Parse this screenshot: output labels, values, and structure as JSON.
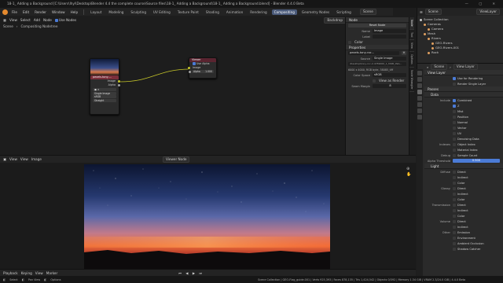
{
  "window": {
    "title": "18-1_ Adding a Background [C:\\Users\\lhyl\\Desktop\\Blender 4.4 the complete course\\Source files\\18-1_ Adding a Background\\18-1_ Adding a Background.blend] - Blender 4.4.0 Beta"
  },
  "menus": [
    "File",
    "Edit",
    "Render",
    "Window",
    "Help"
  ],
  "workspaces": [
    "Layout",
    "Modeling",
    "Sculpting",
    "UV Editing",
    "Texture Paint",
    "Shading",
    "Animation",
    "Rendering",
    "Compositing",
    "Geometry Nodes",
    "Scripting"
  ],
  "active_workspace": "Compositing",
  "scene_label": "Scene",
  "view_layer_label": "ViewLayer",
  "node_editor": {
    "header_items": [
      "View",
      "Select",
      "Add",
      "Node"
    ],
    "use_nodes": "Use Nodes",
    "backdrop": "Backdrop",
    "breadcrumb": [
      "Scene",
      "Compositing Nodetree"
    ],
    "image_node": {
      "title": "pexels-tony-...",
      "outputs": [
        "Image",
        "Alpha"
      ],
      "fields": [
        "Single Image",
        "sRGB",
        "Straight"
      ],
      "field_labels": [
        "",
        "Colo...",
        "Alpha"
      ]
    },
    "viewer_node": {
      "title": "Viewer",
      "rows": [
        "Use Alpha",
        "Image",
        "Alpha"
      ],
      "alpha_value": "1.000"
    }
  },
  "npanel": {
    "node_section": "Node",
    "reset_node": "Reset Node",
    "name_label": "Name",
    "name_value": "Image",
    "label_label": "Label",
    "color_section": "Color",
    "properties_section": "Properties",
    "image_name": "pexels-tony-roc...",
    "source_label": "Source",
    "source_value": "Single Image",
    "file_path": "\\Desktop\\tony-roc-2-4789000_1_MOB_09A...",
    "image_info": "6000 x 4000, RGB byte, 38085_tiff",
    "color_space_label": "Color Space",
    "color_space_value": "sRGB",
    "view_as_render": "View as Render",
    "seam_margin_label": "Seam Margin",
    "seam_margin_value": "8",
    "tabs": [
      "Node",
      "Tool",
      "View",
      "Options",
      "Node Wrangler"
    ]
  },
  "image_editor": {
    "header_items": [
      "View",
      "View",
      "Image"
    ],
    "image_name": "Viewer Node",
    "playback": [
      "Playback",
      "Keying",
      "View",
      "Marker"
    ]
  },
  "outliner": {
    "title": "Scene",
    "items": [
      {
        "label": "Scene Collection",
        "color": "#cccccc",
        "indent": 0
      },
      {
        "label": "Cameras",
        "color": "#e0a060",
        "indent": 1
      },
      {
        "label": "Camera",
        "color": "#e0a060",
        "indent": 2
      },
      {
        "label": "Mesh",
        "color": "#e0a060",
        "indent": 1
      },
      {
        "label": "Rivers",
        "color": "#e0a060",
        "indent": 2
      },
      {
        "label": "GEO-Rivers",
        "color": "#e0a060",
        "indent": 3
      },
      {
        "label": "GEO-Rivers.001",
        "color": "#e0a060",
        "indent": 3
      },
      {
        "label": "Rock",
        "color": "#e0a060",
        "indent": 2
      }
    ]
  },
  "properties": {
    "search_scene": "Scene",
    "search_viewlayer": "View Layer",
    "view_layer_section": "View Layer",
    "use_for_rendering": "Use for Rendering",
    "render_single_layer": "Render Single Layer",
    "passes_section": "Passes",
    "data_section": "Data",
    "include_label": "Include",
    "include_items": [
      {
        "label": "Combined",
        "on": true
      },
      {
        "label": "Z",
        "on": true
      },
      {
        "label": "Mist",
        "on": false
      },
      {
        "label": "Position",
        "on": false
      },
      {
        "label": "Normal",
        "on": false
      },
      {
        "label": "Vector",
        "on": false
      },
      {
        "label": "UV",
        "on": false
      },
      {
        "label": "Denoising Data",
        "on": false
      }
    ],
    "indexes_label": "Indexes",
    "indexes_items": [
      "Object Index",
      "Material Index"
    ],
    "debug_label": "Debug",
    "debug_item": "Sample Count",
    "alpha_threshold_label": "Alpha Threshold",
    "alpha_threshold_value": "0.500",
    "light_section": "Light",
    "light_groups": [
      {
        "label": "Diffuse",
        "items": [
          "Direct",
          "Indirect",
          "Color"
        ]
      },
      {
        "label": "Glossy",
        "items": [
          "Direct",
          "Indirect",
          "Color"
        ]
      },
      {
        "label": "Transmission",
        "items": [
          "Direct",
          "Indirect",
          "Color"
        ]
      },
      {
        "label": "Volume",
        "items": [
          "Direct",
          "Indirect"
        ]
      },
      {
        "label": "Other",
        "items": [
          "Emission",
          "Environment",
          "Ambient Occlusion",
          "Shadow Catcher"
        ]
      }
    ]
  },
  "statusbar": {
    "items": [
      "Select",
      "Pan View",
      "Options"
    ],
    "stats": "Scene Collection | GEO-Flag_guide.001 | Verts 925,393 | Faces 878,135 | Tris 1,424,542 | Objects 0/392 | Memory 1.34 GiB | VRAM 2.3/24.0 GiB | 4.4.0 Beta"
  },
  "colors": {
    "accent": "#4b7bd6",
    "image_node_header": "#7a2e3a",
    "viewer_node_header": "#5a2430",
    "socket_image": "#c7c729",
    "socket_float": "#a1a1a1",
    "brand": "#e58a2e"
  }
}
